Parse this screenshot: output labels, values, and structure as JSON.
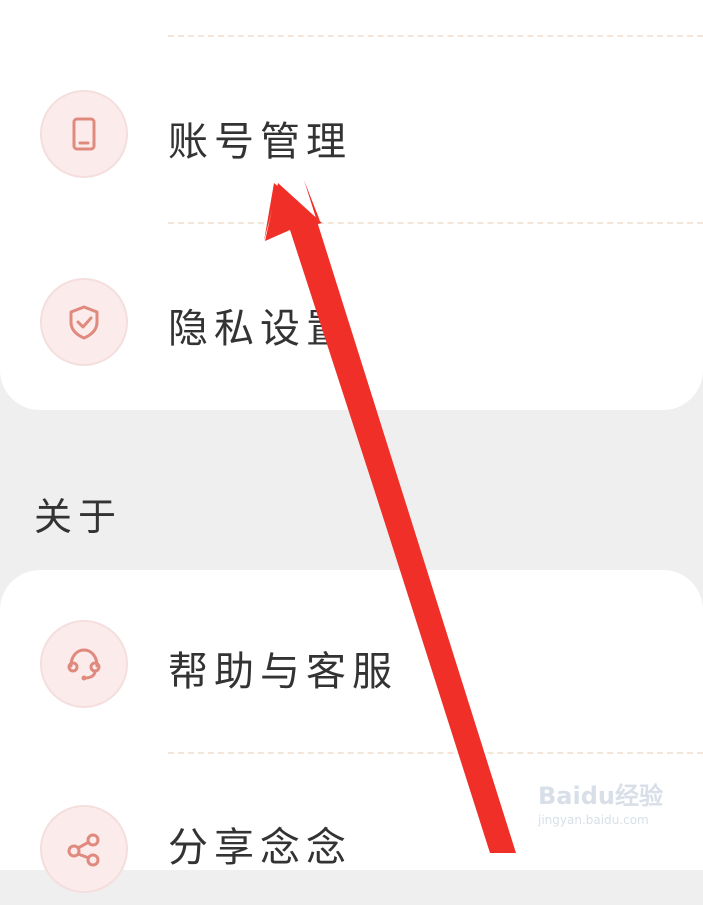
{
  "account": {
    "items": [
      {
        "label": "账号管理",
        "icon": "phone-icon"
      },
      {
        "label": "隐私设置",
        "icon": "shield-check-icon"
      }
    ]
  },
  "about": {
    "section_title": "关于",
    "items": [
      {
        "label": "帮助与客服",
        "icon": "headset-icon"
      },
      {
        "label": "分享念念",
        "icon": "share-icon"
      }
    ]
  },
  "watermark": {
    "brand": "Baidu经验",
    "url": "jingyan.baidu.com"
  },
  "colors": {
    "icon_stroke": "#e08a7f",
    "icon_bg": "#fbeceb",
    "arrow": "#f02f28",
    "page_bg": "#efefef"
  }
}
